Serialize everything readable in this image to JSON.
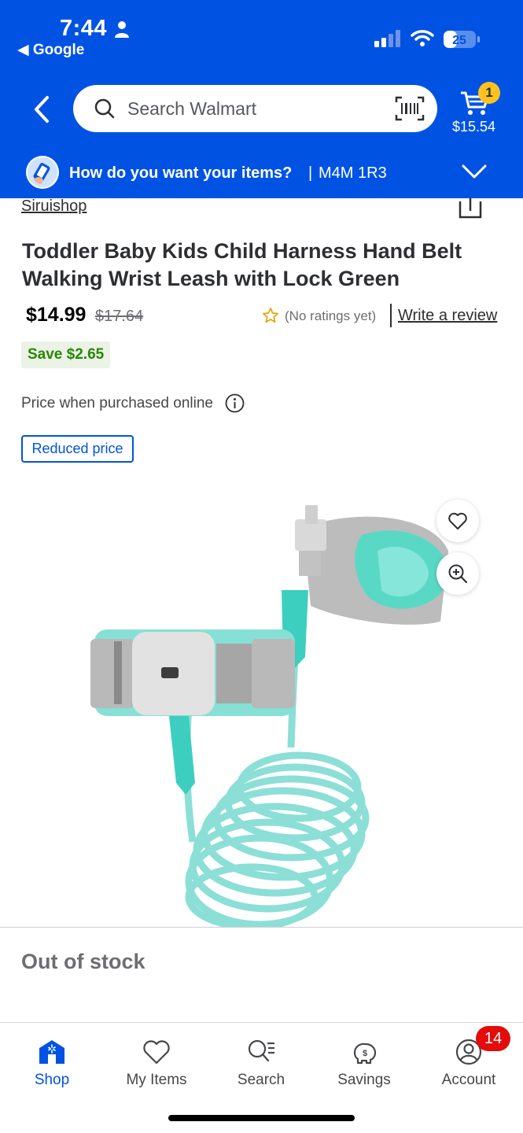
{
  "status_bar": {
    "time": "7:44",
    "back_app": "Google",
    "battery": "25"
  },
  "header": {
    "search_placeholder": "Search Walmart",
    "cart_count": "1",
    "cart_total": "$15.54",
    "fulfillment_question": "How do you want your items?",
    "fulfillment_separator": "|",
    "postal_code": "M4M 1R3",
    "brand_color": "#0053e2"
  },
  "product": {
    "seller": "Siruishop",
    "title": "Toddler Baby Kids Child Harness Hand Belt Walking Wrist Leash with Lock Green",
    "price": "$14.99",
    "was_price": "$17.64",
    "ratings": "(No ratings yet)",
    "write_review": "Write a review",
    "savings": "Save $2.65",
    "price_note": "Price when purchased online",
    "badge": "Reduced price",
    "availability": "Out of stock"
  },
  "tabbar": {
    "items": [
      {
        "label": "Shop",
        "icon": "shop-icon",
        "active": true
      },
      {
        "label": "My Items",
        "icon": "heart-icon",
        "active": false
      },
      {
        "label": "Search",
        "icon": "search-list-icon",
        "active": false
      },
      {
        "label": "Savings",
        "icon": "piggy-bank-icon",
        "active": false
      },
      {
        "label": "Account",
        "icon": "account-icon",
        "active": false
      }
    ],
    "account_badge": "14"
  }
}
